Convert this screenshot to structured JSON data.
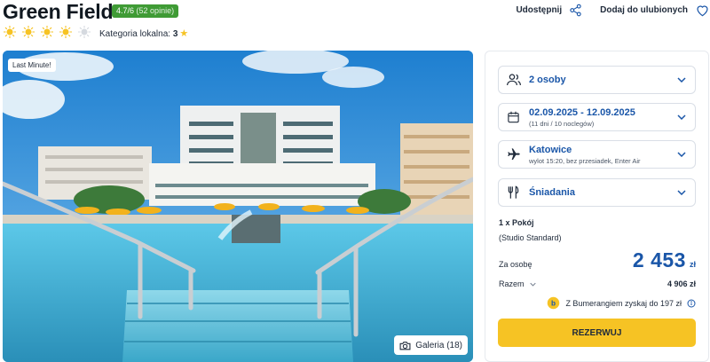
{
  "hotel": {
    "name": "Green Field",
    "rating_score": "4.7/6",
    "rating_count": "(52 opinie)",
    "suns": 5,
    "local_category_label": "Kategoria lokalna:",
    "local_category_value": "3"
  },
  "actions": {
    "share_label": "Udostępnij",
    "favorite_label": "Dodaj do ulubionych"
  },
  "photo": {
    "badge": "Last Minute!",
    "gallery_label": "Galeria (18)"
  },
  "booking": {
    "guests": "2 osoby",
    "dates": "02.09.2025 - 12.09.2025",
    "dates_sub": "(11 dni / 10 noclegów)",
    "departure_city": "Katowice",
    "departure_details": "wylot 15:20, bez przesiadek, Enter Air",
    "board": "Śniadania",
    "room_qty": "1 x Pokój",
    "room_type": "(Studio Standard)",
    "per_person_label": "Za osobę",
    "price_per_person": "2 453",
    "currency": "zł",
    "total_label": "Razem",
    "total_price": "4 906 zł",
    "bumerang_text": "Z Bumerangiem zyskaj do 197 zł",
    "reserve_label": "REZERWUJ"
  },
  "colors": {
    "accent_blue": "#1a56a8",
    "rating_green": "#3f9b35",
    "cta_yellow": "#f6c324",
    "sun_active": "#f6c324",
    "sun_inactive": "#d5d9df"
  }
}
